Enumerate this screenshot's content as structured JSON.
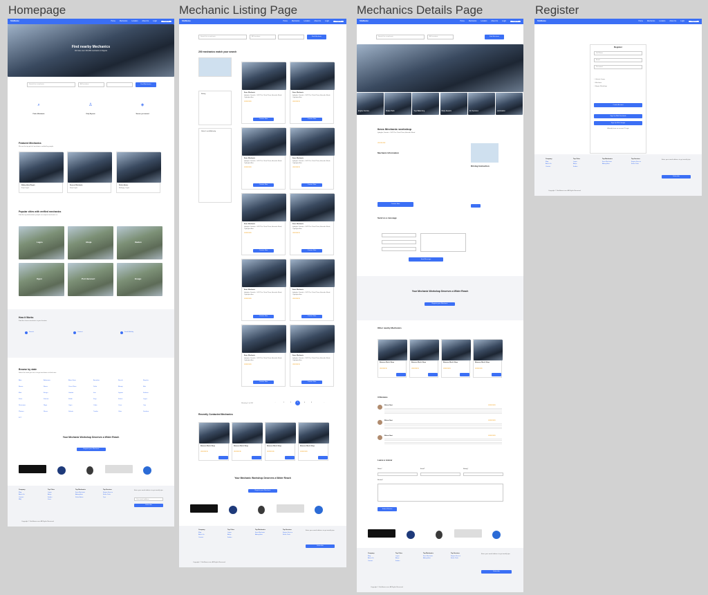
{
  "titles": {
    "homepage": "Homepage",
    "listing": "Mechanic Listing Page",
    "details": "Mechanics Details Page",
    "register": "Register"
  },
  "nav": {
    "logo": "SiteName",
    "items": [
      "Home",
      "Mechanics",
      "Location",
      "About Us",
      "Car Workshop"
    ],
    "login": "Login",
    "register": "Register"
  },
  "home": {
    "hero_title": "Find nearby Mechanics",
    "hero_sub": "We have over 100,000 mechanics in Nigeria",
    "search_placeholder": "Search for a mechanic",
    "location": "All Locations",
    "find_button": "Find Mechanics",
    "features": [
      {
        "title": "Find a Mechanic",
        "icon": "search-icon"
      },
      {
        "title": "Only Experts",
        "icon": "expert-icon"
      },
      {
        "title": "Secure yet trusted",
        "icon": "shield-icon"
      }
    ],
    "featured_title": "Featured Mechanics",
    "featured_sub": "We are the top pick of mechanics verified by people",
    "featured": [
      {
        "name": "Abbey Auto Repair",
        "loc": "Ikeja Lagos"
      },
      {
        "name": "Ibrosmi Mechanic",
        "loc": "Ikeja Lagos"
      },
      {
        "name": "Kelvin Autos",
        "loc": "Badagry, Lagos"
      }
    ],
    "cities_title": "Popular cities with verified mechanics",
    "cities_sub": "Find the top destinations people are request mechanics in",
    "cities": [
      "Lagos",
      "Abuja",
      "Ibadan",
      "Ogun",
      "Port Harcourt",
      "Enugu"
    ],
    "how_title": "How it Works",
    "how_sub": "Find the closest mechanic in your location",
    "steps": [
      "Search",
      "Contact",
      "Feed Mobility"
    ],
    "browse_title": "Browse by state",
    "browse_sub": "Select the state you are in to get mechanics to find ease",
    "states": [
      "Abia",
      "Adamawa",
      "Akwa Ibom",
      "Anambra",
      "Bauchi",
      "Bayelsa",
      "Benue",
      "Borno",
      "Cross River",
      "Delta",
      "Ebonyi",
      "Edo",
      "Ekiti",
      "Enugu",
      "Gombe",
      "Imo",
      "Jigawa",
      "Kaduna",
      "Kano",
      "Katsina",
      "Kebbi",
      "Kogi",
      "Kwara",
      "Lagos",
      "Nasarawa",
      "Niger",
      "Ogun",
      "Ondo",
      "Osun",
      "Oyo",
      "Plateau",
      "Rivers",
      "Sokoto",
      "Taraba",
      "Yobe",
      "Zamfara",
      "FCT"
    ],
    "cta_title": "Your Mechanic Workshop Deserves a Wider Reach",
    "cta_button": "Register your Mechanic"
  },
  "footer": {
    "cols": [
      "Company",
      "Top Cities",
      "Top Mechanics",
      "Top Services"
    ],
    "newsletter": "Enter your email address to get weekly tips",
    "email_placeholder": "Your email address",
    "subscribe": "Subscribe",
    "copyright": "Copyright © SiteName.com. All Rights Reserved"
  },
  "listing": {
    "search_placeholder": "Search for a mechanic",
    "location": "All Locations",
    "find_button": "Find Mechanic",
    "results_title": "200 mechanics match your search",
    "rating_title": "Rating",
    "location_title": "Select Local Authority",
    "card_name": "Ibros Mechanic",
    "card_address": "Igbogbo, Ikorodu - 10/9 The Olivia Plaza, Asarebu Road, Ogbogbo Awo",
    "contact": "Contact Now",
    "showing": "Showing 1 to 200",
    "pages": [
      "1",
      "2",
      "3",
      "4",
      "5"
    ],
    "recent_title": "Recently Contacted Mechanics",
    "recent_name": "Akanmu Mech Shop"
  },
  "details": {
    "name": "Ibros Mechanic workshop",
    "address": "Igbogbo, Ikorodu - 10/9 The Olivia Plaza, Asarebu Road",
    "info_title": "Mechanic Information",
    "contact_button": "Contact Now",
    "message_title": "Send us a message",
    "send_button": "Send Message",
    "driving_title": "Driving Instruction",
    "other_title": "Other nearby Mechanics",
    "reviews_title": "3 Reviews",
    "reviewer": "Bibsin Nasi",
    "leave_review": "Leave a review",
    "name_label": "Name*",
    "email_label": "Email*",
    "rating_label": "Rating*",
    "review_label": "Review*",
    "submit": "Submit Review",
    "thumbs": [
      "Engine Service",
      "Brake Pads",
      "Tyre Balancing",
      "Body Repairs",
      "AC Services",
      "Lubrication"
    ]
  },
  "register": {
    "heading": "Register",
    "fields": [
      "Full Name",
      "Email",
      "Password"
    ],
    "options": [
      "Vehicle Owner",
      "Mechanic",
      "Repair Workshop"
    ],
    "create": "Create Account",
    "google": "Sign Up With Facebook",
    "facebook": "Sign Up With Google",
    "login_prompt": "Already have an account? Login"
  }
}
